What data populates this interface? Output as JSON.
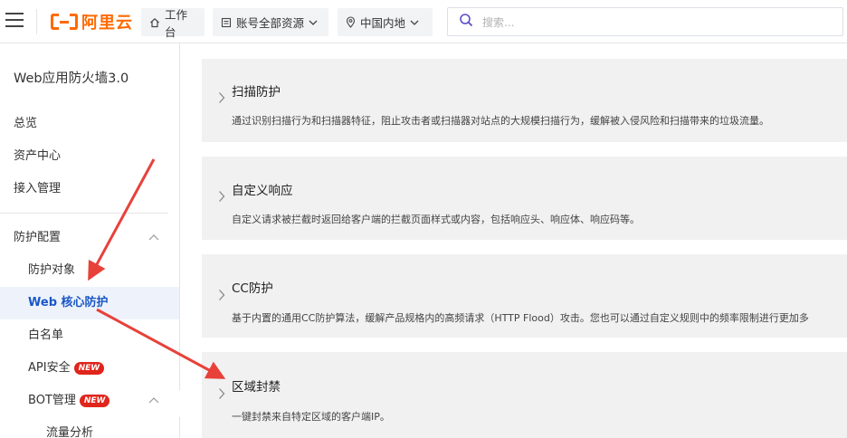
{
  "brand": {
    "logo_text": "阿里云",
    "accent": "#ff6a00"
  },
  "topnav": {
    "workbench_label": "工作台",
    "resources_label": "账号全部资源",
    "region_label": "中国内地",
    "search_placeholder": "搜索..."
  },
  "sidebar": {
    "title": "Web应用防火墙3.0",
    "items": [
      {
        "label": "总览"
      },
      {
        "label": "资产中心"
      },
      {
        "label": "接入管理"
      },
      {
        "label": "防护配置"
      },
      {
        "label": "防护对象"
      },
      {
        "label": "Web 核心防护"
      },
      {
        "label": "白名单"
      },
      {
        "label": "API安全",
        "badge": "NEW"
      },
      {
        "label": "BOT管理",
        "badge": "NEW"
      },
      {
        "label": "流量分析"
      }
    ],
    "active_color": "#1a56c7"
  },
  "cards": [
    {
      "title": "扫描防护",
      "desc": "通过识别扫描行为和扫描器特征，阻止攻击者或扫描器对站点的大规模扫描行为，缓解被入侵风险和扫描带来的垃圾流量。"
    },
    {
      "title": "自定义响应",
      "desc": "自定义请求被拦截时返回给客户端的拦截页面样式或内容，包括响应头、响应体、响应码等。"
    },
    {
      "title": "CC防护",
      "desc": "基于内置的通用CC防护算法，缓解产品规格内的高频请求（HTTP Flood）攻击。您也可以通过自定义规则中的频率限制进行更加多"
    },
    {
      "title": "区域封禁",
      "desc": "一键封禁来自特定区域的客户端IP。"
    }
  ],
  "annotation_color": "#e8413a"
}
